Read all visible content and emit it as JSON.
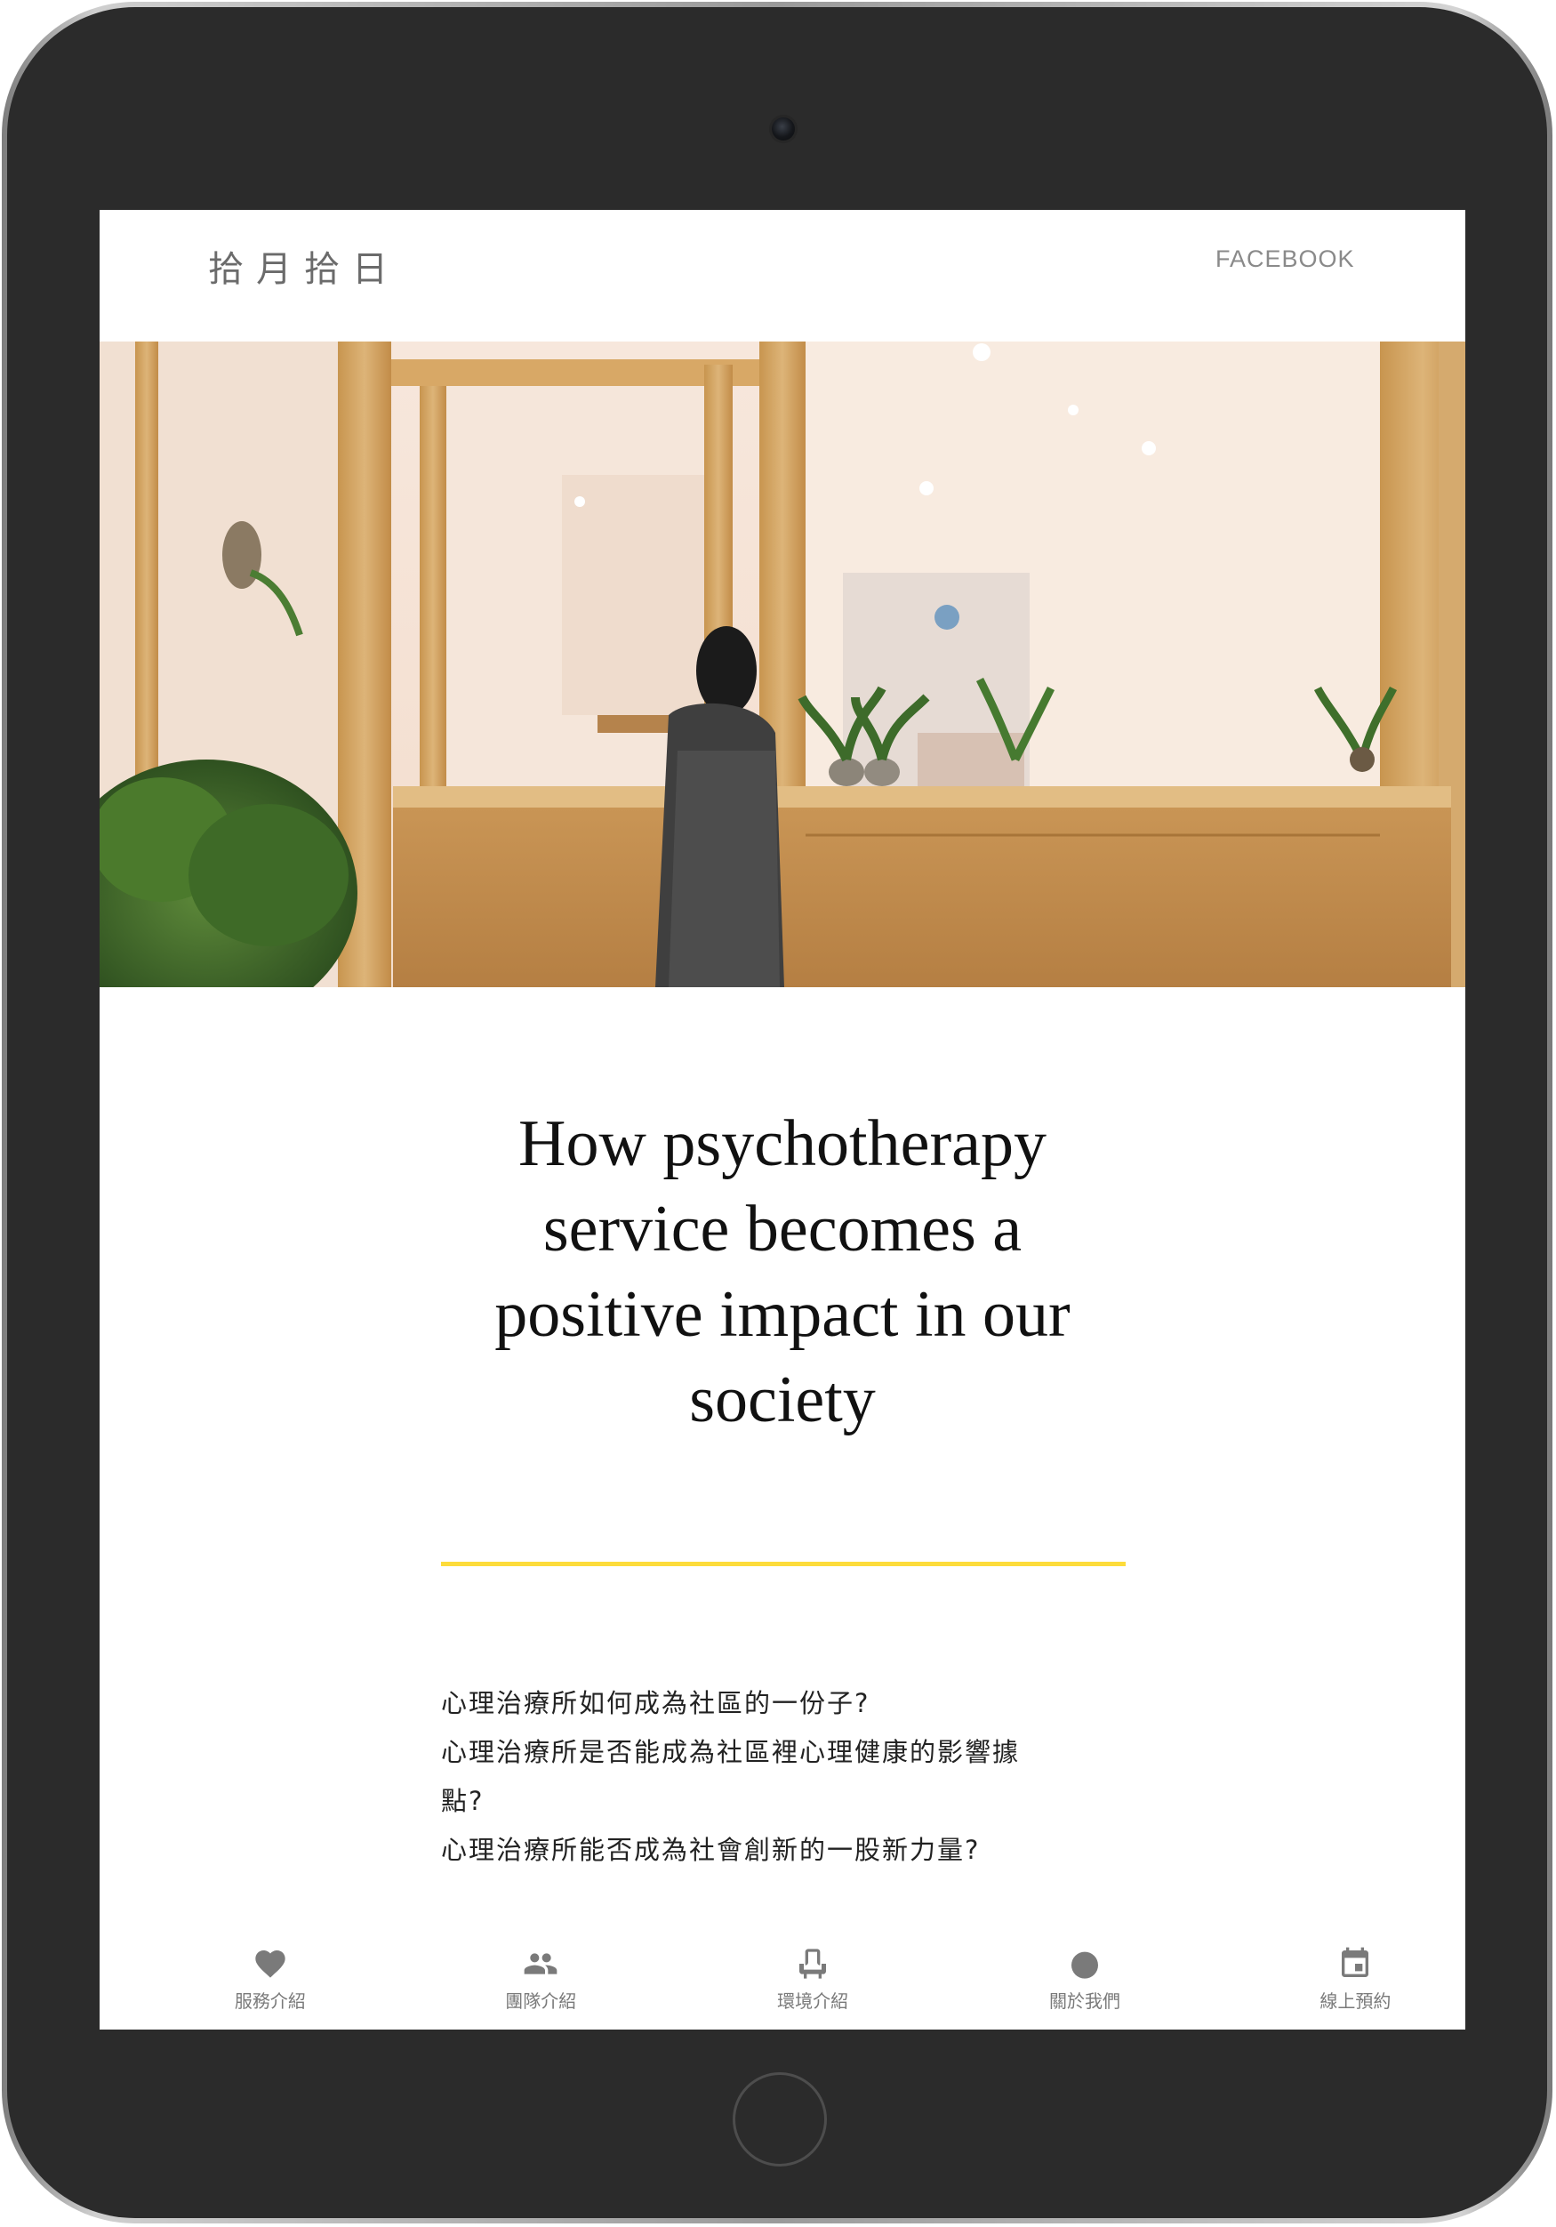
{
  "header": {
    "logo": "拾月拾日",
    "facebook_label": "FACEBOOK"
  },
  "hero": {
    "image": "clinic-interior-photo"
  },
  "article": {
    "headline_lines": [
      "How psychotherapy",
      "service becomes a",
      "positive impact in our",
      "society"
    ],
    "accent_color": "#fddc3a",
    "paragraph_lines": [
      "心理治療所如何成為社區的一份子?",
      "心理治療所是否能成為社區裡心理健康的影響據",
      "點?",
      "心理治療所能否成為社會創新的一股新力量?"
    ]
  },
  "bottom_nav": {
    "items": [
      {
        "label": "服務介紹",
        "icon": "heart-icon"
      },
      {
        "label": "團隊介紹",
        "icon": "people-icon"
      },
      {
        "label": "環境介紹",
        "icon": "chair-icon"
      },
      {
        "label": "關於我們",
        "icon": "circle-icon"
      },
      {
        "label": "線上預約",
        "icon": "calendar-icon"
      }
    ]
  }
}
